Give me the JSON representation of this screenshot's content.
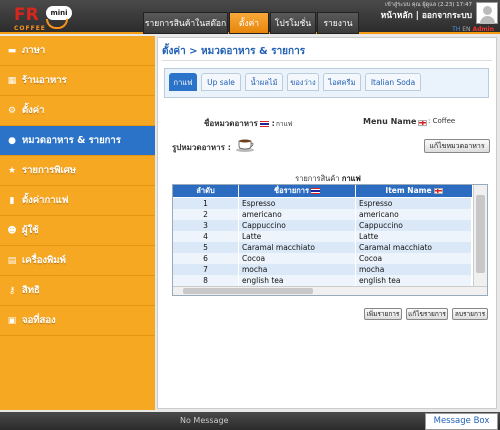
{
  "logo": {
    "brand": "FR",
    "badge": "mini",
    "sub": "COFFEE"
  },
  "topnav": [
    {
      "label": "รายการสินค้าในสต๊อก",
      "active": false
    },
    {
      "label": "ตั้งค่า",
      "active": true
    },
    {
      "label": "โปรโมชั่น",
      "active": false
    },
    {
      "label": "รายงาน",
      "active": false
    }
  ],
  "header": {
    "user_info": "เข้าสู่ระบบ คุณ ผู้ดูแล (2.23) 17:47",
    "home_link": "หน้าหลัก",
    "separator": "|",
    "logout_link": "ออกจากระบบ",
    "lang_th": "TH",
    "lang_en": "EN",
    "admin_label": "Admin"
  },
  "sidebar": {
    "items": [
      {
        "label": "ภาษา",
        "icon": "flag-icon",
        "glyph": "▬",
        "active": false
      },
      {
        "label": "ร้านอาหาร",
        "icon": "store-icon",
        "glyph": "▦",
        "active": false
      },
      {
        "label": "ตั้งค่า",
        "icon": "gear-icon",
        "glyph": "⚙",
        "active": false
      },
      {
        "label": "หมวดอาหาร & รายการ",
        "icon": "food-category-icon",
        "glyph": "●",
        "active": true
      },
      {
        "label": "รายการพิเศษ",
        "icon": "star-icon",
        "glyph": "★",
        "active": false
      },
      {
        "label": "ตั้งค่ากาแฟ",
        "icon": "coffee-icon",
        "glyph": "▮",
        "active": false
      },
      {
        "label": "ผู้ใช้",
        "icon": "users-icon",
        "glyph": "☻",
        "active": false
      },
      {
        "label": "เครื่องพิมพ์",
        "icon": "printer-icon",
        "glyph": "▤",
        "active": false
      },
      {
        "label": "สิทธิ",
        "icon": "key-icon",
        "glyph": "⚷",
        "active": false
      },
      {
        "label": "จอที่สอง",
        "icon": "screen-icon",
        "glyph": "▣",
        "active": false
      }
    ]
  },
  "main": {
    "breadcrumb": "ตั้งค่า > หมวดอาหาร & รายการ",
    "tabs": [
      {
        "label": "กาแฟ",
        "active": true
      },
      {
        "label": "Up sale",
        "active": false
      },
      {
        "label": "น้ำผลไม้",
        "active": false
      },
      {
        "label": "ของว่าง",
        "active": false
      },
      {
        "label": "ไอศครีม",
        "active": false
      },
      {
        "label": "Italian Soda",
        "active": false
      }
    ],
    "category_label": "ชื่อหมวดอาหาร",
    "category_value": "กาแฟ",
    "menu_name_label": "Menu Name",
    "menu_name_value": "Coffee",
    "picture_label": "รูปหมวดอาหาร :",
    "picture_icon": "coffee-cup-icon",
    "edit_category_button": "แก้ไขหมวดอาหาร",
    "list_caption_prefix": "รายการสินค้า",
    "list_caption_value": "กาแฟ",
    "table": {
      "columns": [
        "ลำดับ",
        "ชื่อรายการ",
        "Item Name"
      ],
      "rows": [
        [
          "1",
          "Espresso",
          "Espresso"
        ],
        [
          "2",
          "americano",
          "americano"
        ],
        [
          "3",
          "Cappuccino",
          "Cappuccino"
        ],
        [
          "4",
          "Latte",
          "Latte"
        ],
        [
          "5",
          "Caramal macchiato",
          "Caramal macchiato"
        ],
        [
          "6",
          "Cocoa",
          "Cocoa"
        ],
        [
          "7",
          "mocha",
          "mocha"
        ],
        [
          "8",
          "english tea",
          "english tea"
        ]
      ]
    },
    "buttons": {
      "add": "เพิ่มรายการ",
      "edit": "แก้ไขรายการ",
      "delete": "ลบรายการ"
    }
  },
  "footer": {
    "status": "No Message",
    "message_box": "Message Box"
  },
  "colors": {
    "accent": "#f7a823",
    "active_blue": "#2b73c9",
    "brand_red": "#d9261c"
  }
}
